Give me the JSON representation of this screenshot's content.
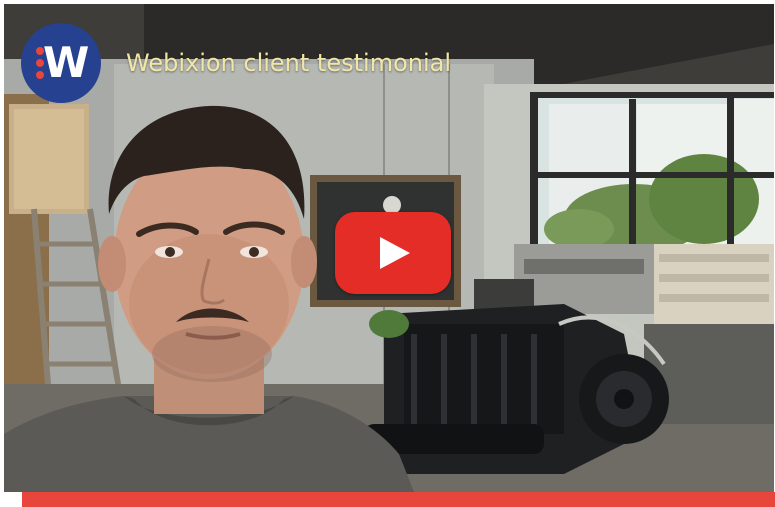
{
  "video": {
    "title": "Webixion client testimonial",
    "logo_letter": "W"
  },
  "colors": {
    "logo_background": "#25418f",
    "logo_dots": "#e8453c",
    "title_text": "#f2e6a7",
    "play_button": "#e52d27",
    "accent_bar": "#e8453c"
  },
  "icons": {
    "play": "play-icon"
  }
}
